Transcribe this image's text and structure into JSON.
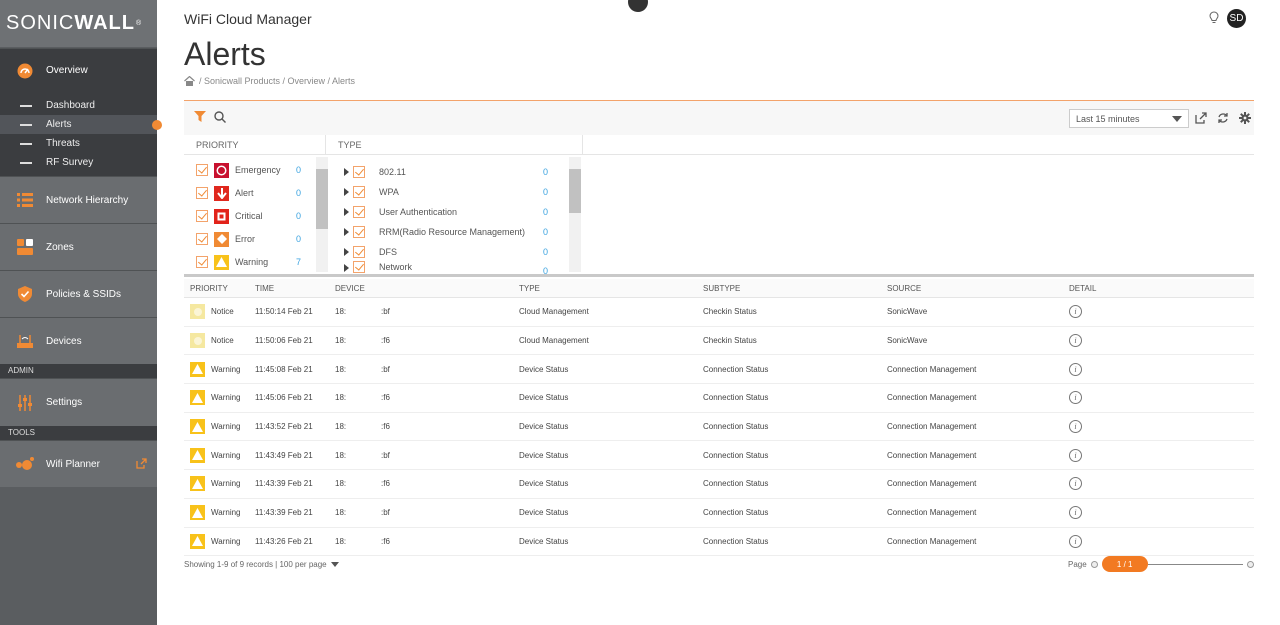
{
  "brand": {
    "logo_light": "SONIC",
    "logo_bold": "WALL",
    "logo_mark": "®"
  },
  "sidebar": {
    "overview_label": "Overview",
    "sub_items": [
      {
        "label": "Dashboard"
      },
      {
        "label": "Alerts"
      },
      {
        "label": "Threats"
      },
      {
        "label": "RF Survey"
      }
    ],
    "network_hierarchy_label": "Network Hierarchy",
    "zones_label": "Zones",
    "policies_label": "Policies & SSIDs",
    "devices_label": "Devices",
    "admin_section": "ADMIN",
    "settings_label": "Settings",
    "tools_section": "TOOLS",
    "wifi_planner_label": "Wifi Planner"
  },
  "header": {
    "app_title": "WiFi Cloud Manager",
    "page_title": "Alerts",
    "breadcrumb": "/ Sonicwall Products / Overview / Alerts",
    "avatar": "SD"
  },
  "toolbar": {
    "time_range": "Last 15 minutes"
  },
  "filters": {
    "priority_header": "PRIORITY",
    "type_header": "TYPE",
    "priorities": [
      {
        "label": "Emergency",
        "count": "0",
        "color": "#c8102e",
        "glyph": "!"
      },
      {
        "label": "Alert",
        "count": "0",
        "color": "#e0281e",
        "glyph": "↓"
      },
      {
        "label": "Critical",
        "count": "0",
        "color": "#e2231a",
        "glyph": "■"
      },
      {
        "label": "Error",
        "count": "0",
        "color": "#f08a34",
        "glyph": "◆"
      },
      {
        "label": "Warning",
        "count": "7",
        "color": "#f8c21a",
        "glyph": "▲"
      }
    ],
    "types": [
      {
        "label": "802.11",
        "count": "0"
      },
      {
        "label": "WPA",
        "count": "0"
      },
      {
        "label": "User Authentication",
        "count": "0"
      },
      {
        "label": "RRM(Radio Resource Management)",
        "count": "0"
      },
      {
        "label": "DFS",
        "count": "0"
      },
      {
        "label": "Network",
        "count": "0"
      }
    ]
  },
  "table": {
    "headers": [
      "PRIORITY",
      "TIME",
      "DEVICE",
      "TYPE",
      "SUBTYPE",
      "SOURCE",
      "DETAIL"
    ],
    "rows": [
      {
        "priority": "Notice",
        "sev": "notice",
        "time": "11:50:14 Feb 21",
        "dev_a": "18:",
        "dev_b": ":bf",
        "type": "Cloud Management",
        "subtype": "Checkin Status",
        "source": "SonicWave"
      },
      {
        "priority": "Notice",
        "sev": "notice",
        "time": "11:50:06 Feb 21",
        "dev_a": "18:",
        "dev_b": ":f6",
        "type": "Cloud Management",
        "subtype": "Checkin Status",
        "source": "SonicWave"
      },
      {
        "priority": "Warning",
        "sev": "warning",
        "time": "11:45:08 Feb 21",
        "dev_a": "18:",
        "dev_b": ":bf",
        "type": "Device Status",
        "subtype": "Connection Status",
        "source": "Connection Management"
      },
      {
        "priority": "Warning",
        "sev": "warning",
        "time": "11:45:06 Feb 21",
        "dev_a": "18:",
        "dev_b": ":f6",
        "type": "Device Status",
        "subtype": "Connection Status",
        "source": "Connection Management"
      },
      {
        "priority": "Warning",
        "sev": "warning",
        "time": "11:43:52 Feb 21",
        "dev_a": "18:",
        "dev_b": ":f6",
        "type": "Device Status",
        "subtype": "Connection Status",
        "source": "Connection Management"
      },
      {
        "priority": "Warning",
        "sev": "warning",
        "time": "11:43:49 Feb 21",
        "dev_a": "18:",
        "dev_b": ":bf",
        "type": "Device Status",
        "subtype": "Connection Status",
        "source": "Connection Management"
      },
      {
        "priority": "Warning",
        "sev": "warning",
        "time": "11:43:39 Feb 21",
        "dev_a": "18:",
        "dev_b": ":f6",
        "type": "Device Status",
        "subtype": "Connection Status",
        "source": "Connection Management"
      },
      {
        "priority": "Warning",
        "sev": "warning",
        "time": "11:43:39 Feb 21",
        "dev_a": "18:",
        "dev_b": ":bf",
        "type": "Device Status",
        "subtype": "Connection Status",
        "source": "Connection Management"
      },
      {
        "priority": "Warning",
        "sev": "warning",
        "time": "11:43:26 Feb 21",
        "dev_a": "18:",
        "dev_b": ":f6",
        "type": "Device Status",
        "subtype": "Connection Status",
        "source": "Connection Management"
      }
    ]
  },
  "footer": {
    "records": "Showing 1-9 of 9 records | 100 per page",
    "page_label": "Page",
    "page_value": "1 / 1"
  },
  "colors": {
    "accent": "#f08a34",
    "link": "#3ba3e0",
    "sidebar": "#5a5d60"
  }
}
